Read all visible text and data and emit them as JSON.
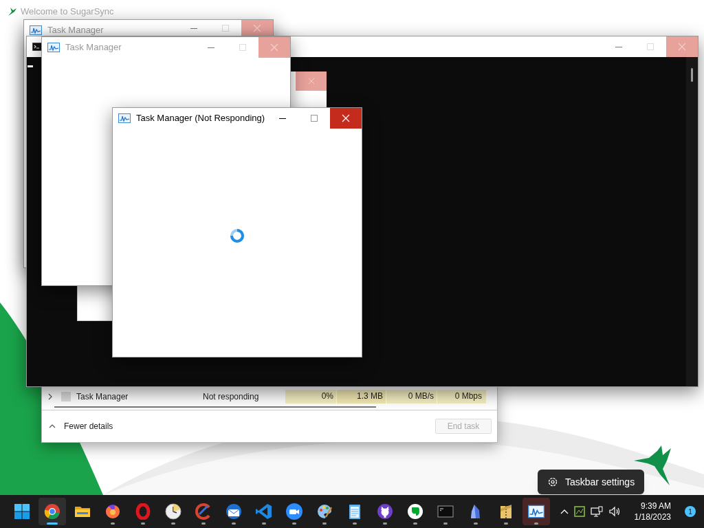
{
  "background_app": {
    "title": "Welcome to SugarSync"
  },
  "windows": [
    {
      "kind": "taskmgr",
      "title": "Task Manager",
      "focused": false
    },
    {
      "kind": "console",
      "focused": false
    },
    {
      "kind": "taskmgr",
      "title": "Task Manager",
      "focused": false
    },
    {
      "kind": "taskmgr",
      "title": "Task Manager (Not Responding)",
      "focused": true,
      "busy": true
    }
  ],
  "details_window": {
    "process_row": {
      "expanded": false,
      "name": "Task Manager",
      "status": "Not responding",
      "cpu": "0%",
      "memory": "1.3 MB",
      "disk": "0 MB/s",
      "network": "0 Mbps"
    },
    "toggle": "Fewer details",
    "end_button": {
      "label": "End task",
      "disabled": true
    }
  },
  "tooltip": {
    "label": "Taskbar settings"
  },
  "taskbar": {
    "apps": [
      {
        "kind": "start",
        "selected": false,
        "running": false,
        "flashing": false
      },
      {
        "kind": "chrome",
        "selected": true,
        "running": true,
        "flashing": false
      },
      {
        "kind": "folder",
        "selected": false,
        "running": false,
        "flashing": false
      },
      {
        "kind": "firefox",
        "selected": false,
        "running": true,
        "flashing": false
      },
      {
        "kind": "opera",
        "selected": false,
        "running": true,
        "flashing": false
      },
      {
        "kind": "clock",
        "selected": false,
        "running": true,
        "flashing": false
      },
      {
        "kind": "ccleaner",
        "selected": false,
        "running": true,
        "flashing": false
      },
      {
        "kind": "mail",
        "selected": false,
        "running": true,
        "flashing": false
      },
      {
        "kind": "vscode",
        "selected": false,
        "running": true,
        "flashing": false
      },
      {
        "kind": "zoom",
        "selected": false,
        "running": true,
        "flashing": false
      },
      {
        "kind": "paint",
        "selected": false,
        "running": true,
        "flashing": false
      },
      {
        "kind": "notepad",
        "selected": false,
        "running": true,
        "flashing": false
      },
      {
        "kind": "github",
        "selected": false,
        "running": true,
        "flashing": false
      },
      {
        "kind": "evernote",
        "selected": false,
        "running": true,
        "flashing": false
      },
      {
        "kind": "console",
        "selected": false,
        "running": true,
        "flashing": false
      },
      {
        "kind": "crystal",
        "selected": false,
        "running": true,
        "flashing": false
      },
      {
        "kind": "archive",
        "selected": false,
        "running": true,
        "flashing": false
      },
      {
        "kind": "taskmgr",
        "selected": false,
        "running": true,
        "flashing": true
      }
    ],
    "clock": {
      "time": "9:39 AM",
      "date": "1/18/2023"
    },
    "notification_count": "1"
  }
}
